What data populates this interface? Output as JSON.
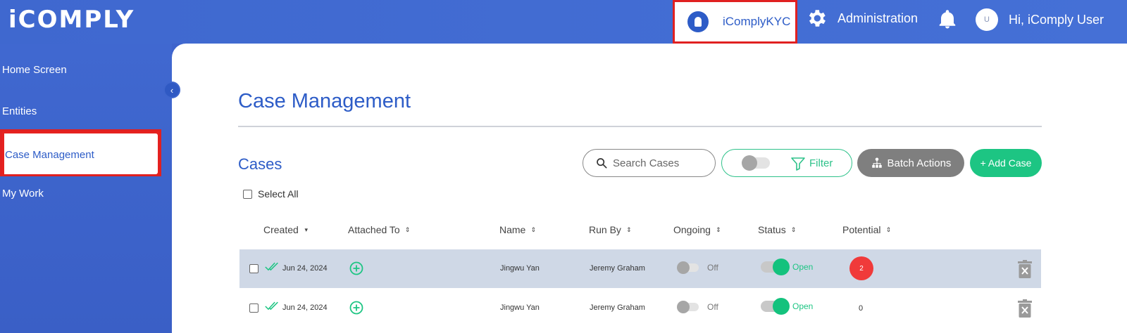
{
  "header": {
    "logo": "iCOMPLY",
    "kyc_label": "iComplyKYC",
    "admin_label": "Administration",
    "avatar_initial": "U",
    "greeting": "Hi, iComply User"
  },
  "sidebar": {
    "items": [
      {
        "label": "Home Screen"
      },
      {
        "label": "Entities"
      },
      {
        "label": "Case Management",
        "active": true
      },
      {
        "label": "My Work"
      }
    ],
    "collapse_glyph": "‹"
  },
  "main": {
    "title": "Case Management",
    "cases_title": "Cases",
    "select_all": "Select All",
    "search_placeholder": "Search Cases",
    "filter_label": "Filter",
    "batch_label": "Batch Actions",
    "add_case_label": "+ Add Case",
    "columns": [
      {
        "label": "Created",
        "sort": "▾"
      },
      {
        "label": "Attached To",
        "sort": "⇕"
      },
      {
        "label": "Name",
        "sort": "⇕"
      },
      {
        "label": "Run By",
        "sort": "⇕"
      },
      {
        "label": "Ongoing",
        "sort": "⇕"
      },
      {
        "label": "Status",
        "sort": "⇕"
      },
      {
        "label": "Potential",
        "sort": "⇕"
      }
    ],
    "rows": [
      {
        "created": "Jun 24, 2024",
        "name": "Jingwu Yan",
        "run_by": "Jeremy Graham",
        "ongoing": "Off",
        "status": "Open",
        "potential": "2",
        "highlighted": true
      },
      {
        "created": "Jun 24, 2024",
        "name": "Jingwu Yan",
        "run_by": "Jeremy Graham",
        "ongoing": "Off",
        "status": "Open",
        "potential": "0",
        "highlighted": false
      }
    ]
  },
  "colors": {
    "primary": "#3f68cf",
    "accent_green": "#1dc583",
    "highlight_red": "#e02020",
    "badge_red": "#f03a3a"
  }
}
